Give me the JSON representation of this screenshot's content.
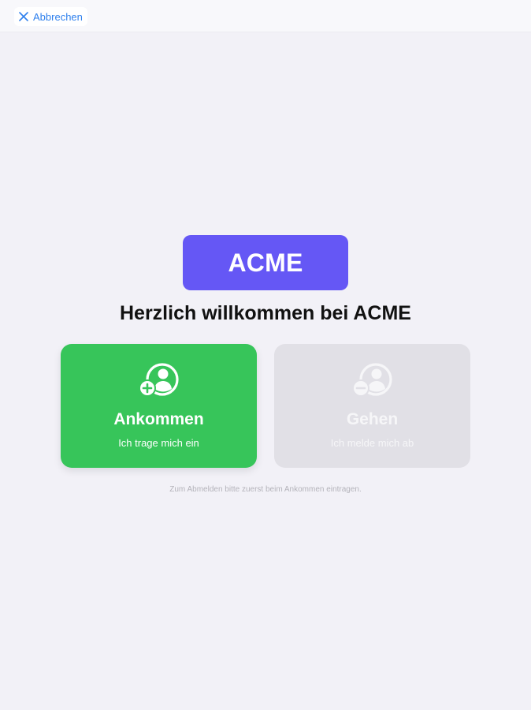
{
  "header": {
    "cancel_label": "Abbrechen",
    "cancel_icon": "close-icon"
  },
  "logo": {
    "text": "ACME",
    "color": "#6557f5"
  },
  "welcome_text": "Herzlich willkommen bei ACME",
  "actions": {
    "check_in": {
      "title": "Ankommen",
      "subtitle": "Ich trage mich ein",
      "icon": "user-add-icon",
      "color": "#37c55a",
      "enabled": true
    },
    "check_out": {
      "title": "Gehen",
      "subtitle": "Ich melde mich ab",
      "icon": "user-remove-icon",
      "color": "#e1e0e6",
      "enabled": false
    }
  },
  "hint_text": "Zum Abmelden bitte zuerst beim Ankommen eintragen."
}
